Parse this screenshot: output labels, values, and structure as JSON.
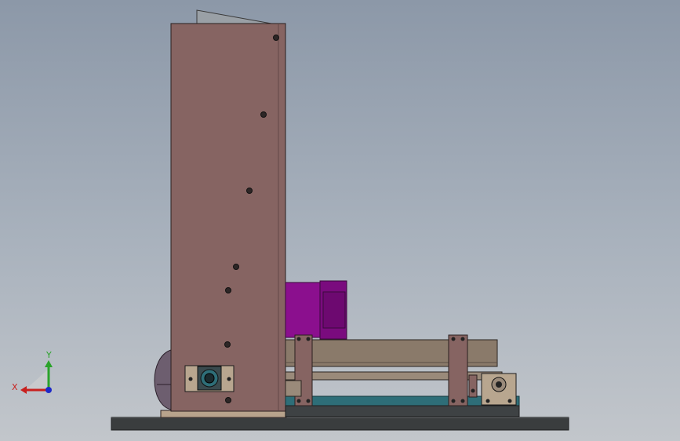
{
  "viewport": {
    "background_top": "#8c98a8",
    "background_bottom": "#c2c6cb"
  },
  "colors": {
    "panel": "#866462",
    "panel_edge": "#2a1f1f",
    "motor": "#8b0f8e",
    "motor_cap": "#7a0b7e",
    "rail": "#8a7a6a",
    "base": "#3a3d3e",
    "teal_rail": "#2e6e78",
    "axis_x": "#c8201e",
    "axis_y": "#2aa32a",
    "axis_z": "#1e2ac8"
  },
  "triad": {
    "x_label": "X",
    "y_label": "Y",
    "z_icon": "z-axis-dot-icon"
  }
}
